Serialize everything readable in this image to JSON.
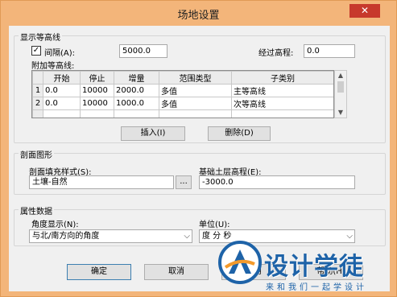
{
  "window": {
    "title": "场地设置",
    "close_glyph": "✕"
  },
  "contours": {
    "group_title": "显示等高线",
    "interval_checked": true,
    "interval_label": "间隔(A):",
    "interval_value": "5000.0",
    "passing_elev_label": "经过高程:",
    "passing_elev_value": "0.0",
    "additional_label": "附加等高线:",
    "columns": [
      "",
      "开始",
      "停止",
      "增量",
      "范围类型",
      "子类别"
    ],
    "rows": [
      {
        "num": "1",
        "start": "0.0",
        "stop": "10000",
        "increment": "2000.0",
        "range_type": "多值",
        "subcategory": "主等高线"
      },
      {
        "num": "2",
        "start": "0.0",
        "stop": "10000",
        "increment": "1000.0",
        "range_type": "多值",
        "subcategory": "次等高线"
      }
    ],
    "insert_label": "插入(I)",
    "delete_label": "删除(D)"
  },
  "section": {
    "group_title": "剖面图形",
    "fill_pattern_label": "剖面填充样式(S):",
    "fill_pattern_value": "土壤-自然",
    "browse_label": "...",
    "base_elev_label": "基础土层高程(E):",
    "base_elev_value": "-3000.0"
  },
  "properties": {
    "group_title": "属性数据",
    "angle_label": "角度显示(N):",
    "angle_value": "与北/南方向的角度",
    "units_label": "单位(U):",
    "units_value": "度 分 秒"
  },
  "footer": {
    "ok_label": "确定",
    "cancel_label": "取消",
    "apply_label": "应用",
    "help_label": "帮助(H)"
  },
  "watermark": {
    "title": "设计学徒",
    "subtitle": "来和我们一起学设计"
  },
  "colors": {
    "titlebar": "#f3b57a",
    "close": "#c7392c",
    "brand": "#1e63a8",
    "brand_accent": "#f39a2c"
  }
}
